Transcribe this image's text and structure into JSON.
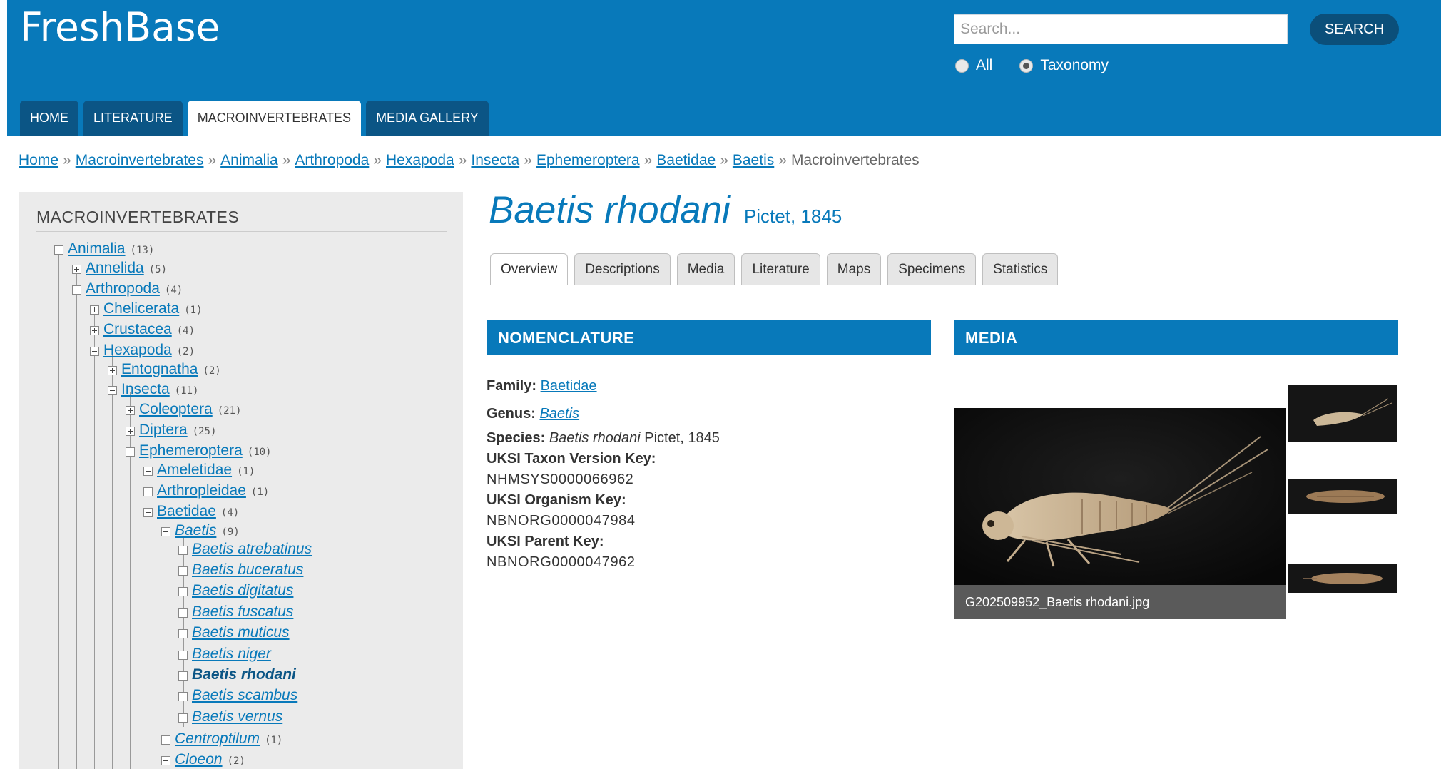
{
  "header": {
    "logo": "FreshBase",
    "search_placeholder": "Search...",
    "search_button": "SEARCH",
    "radio_all": "All",
    "radio_taxonomy": "Taxonomy"
  },
  "nav": {
    "home": "HOME",
    "literature": "LITERATURE",
    "macroinvertebrates": "MACROINVERTEBRATES",
    "media_gallery": "MEDIA GALLERY"
  },
  "breadcrumb": {
    "items": [
      "Home",
      "Macroinvertebrates",
      "Animalia",
      "Arthropoda",
      "Hexapoda",
      "Insecta",
      "Ephemeroptera",
      "Baetidae",
      "Baetis"
    ],
    "current": "Macroinvertebrates",
    "separator": "»"
  },
  "sidebar": {
    "title": "MACROINVERTEBRATES",
    "tree": [
      {
        "label": "Animalia",
        "count": "(13)"
      },
      {
        "label": "Annelida",
        "count": "(5)"
      },
      {
        "label": "Arthropoda",
        "count": "(4)"
      },
      {
        "label": "Chelicerata",
        "count": "(1)"
      },
      {
        "label": "Crustacea",
        "count": "(4)"
      },
      {
        "label": "Hexapoda",
        "count": "(2)"
      },
      {
        "label": "Entognatha",
        "count": "(2)"
      },
      {
        "label": "Insecta",
        "count": "(11)"
      },
      {
        "label": "Coleoptera",
        "count": "(21)"
      },
      {
        "label": "Diptera",
        "count": "(25)"
      },
      {
        "label": "Ephemeroptera",
        "count": "(10)"
      },
      {
        "label": "Ameletidae",
        "count": "(1)"
      },
      {
        "label": "Arthropleidae",
        "count": "(1)"
      },
      {
        "label": "Baetidae",
        "count": "(4)"
      },
      {
        "label": "Baetis",
        "count": "(9)"
      },
      {
        "label": "Baetis atrebatinus",
        "count": ""
      },
      {
        "label": "Baetis buceratus",
        "count": ""
      },
      {
        "label": "Baetis digitatus",
        "count": ""
      },
      {
        "label": "Baetis fuscatus",
        "count": ""
      },
      {
        "label": "Baetis muticus",
        "count": ""
      },
      {
        "label": "Baetis niger",
        "count": ""
      },
      {
        "label": "Baetis rhodani",
        "count": ""
      },
      {
        "label": "Baetis scambus",
        "count": ""
      },
      {
        "label": "Baetis vernus",
        "count": ""
      },
      {
        "label": "Centroptilum",
        "count": "(1)"
      },
      {
        "label": "Cloeon",
        "count": "(2)"
      }
    ]
  },
  "species": {
    "name": "Baetis rhodani",
    "author": "Pictet, 1845"
  },
  "tabs": [
    "Overview",
    "Descriptions",
    "Media",
    "Literature",
    "Maps",
    "Specimens",
    "Statistics"
  ],
  "nomenclature": {
    "header": "NOMENCLATURE",
    "family_label": "Family:",
    "family_value": "Baetidae",
    "genus_label": "Genus:",
    "genus_value": "Baetis",
    "species_label": "Species:",
    "species_value": "Baetis rhodani",
    "species_author": "Pictet, 1845",
    "taxon_key_label": "UKSI Taxon Version Key:",
    "taxon_key_value": "NHMSYS0000066962",
    "organism_key_label": "UKSI Organism Key:",
    "organism_key_value": "NBNORG0000047984",
    "parent_key_label": "UKSI Parent Key:",
    "parent_key_value": "NBNORG0000047962"
  },
  "media": {
    "header": "MEDIA",
    "caption": "G202509952_Baetis rhodani.jpg"
  },
  "colors": {
    "brand_blue": "#0879ba",
    "nav_dark_blue": "#0b5585",
    "sidebar_bg": "#ebebeb"
  }
}
